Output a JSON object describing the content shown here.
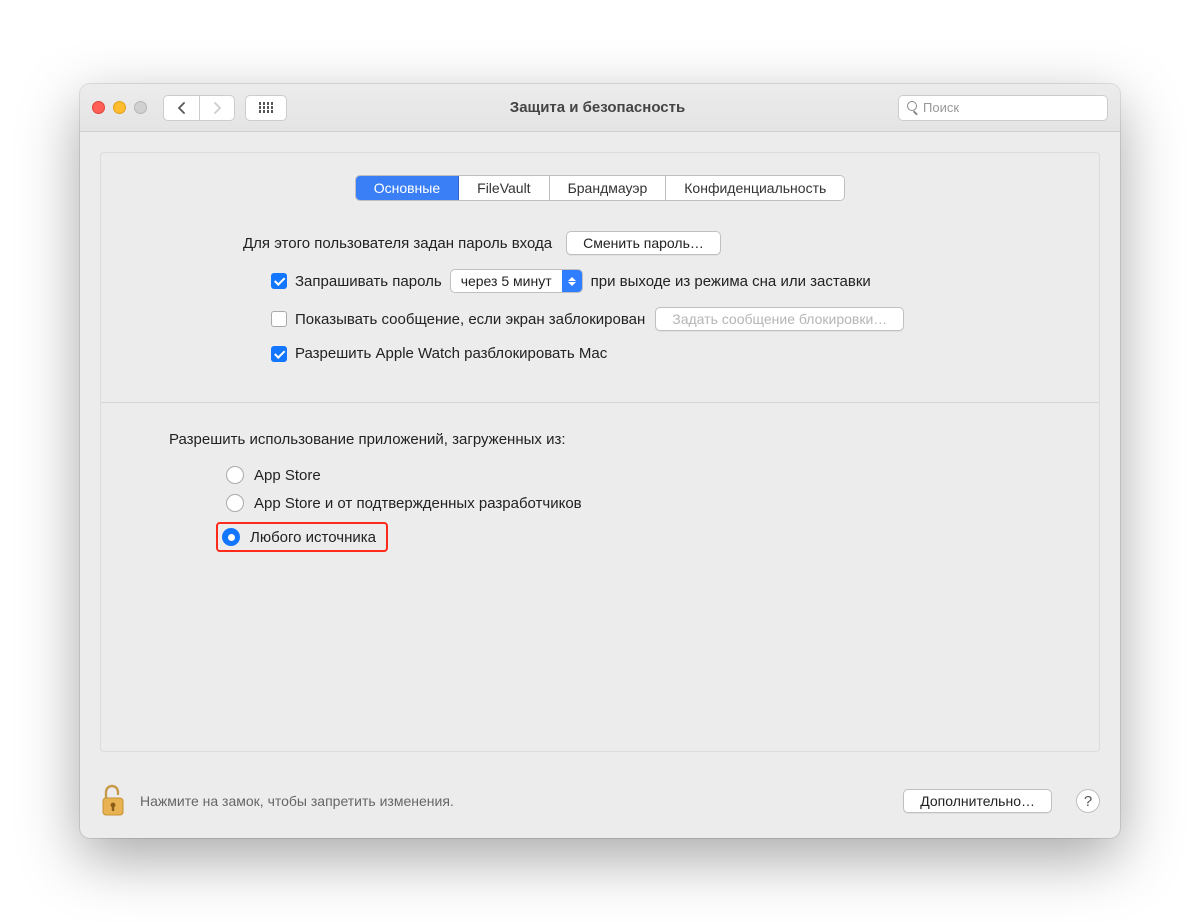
{
  "window": {
    "title": "Защита и безопасность",
    "search_placeholder": "Поиск"
  },
  "tabs": [
    {
      "id": "general",
      "label": "Основные",
      "active": true
    },
    {
      "id": "filevault",
      "label": "FileVault",
      "active": false
    },
    {
      "id": "firewall",
      "label": "Брандмауэр",
      "active": false
    },
    {
      "id": "privacy",
      "label": "Конфиденциальность",
      "active": false
    }
  ],
  "login": {
    "password_set_label": "Для этого пользователя задан пароль входа",
    "change_password_btn": "Сменить пароль…",
    "require_password_label": "Запрашивать пароль",
    "delay_value": "через 5 минут",
    "after_sleep_label": "при выходе из режима сна или заставки",
    "show_message_label": "Показывать сообщение, если экран заблокирован",
    "set_lock_message_btn": "Задать сообщение блокировки…",
    "allow_apple_watch_label": "Разрешить Apple Watch разблокировать Mac"
  },
  "gatekeeper": {
    "section_title": "Разрешить использование приложений, загруженных из:",
    "options": [
      {
        "id": "appstore",
        "label": "App Store",
        "selected": false
      },
      {
        "id": "identified",
        "label": "App Store и от подтвержденных разработчиков",
        "selected": false
      },
      {
        "id": "anywhere",
        "label": "Любого источника",
        "selected": true
      }
    ]
  },
  "footer": {
    "lock_text": "Нажмите на замок, чтобы запретить изменения.",
    "advanced_btn": "Дополнительно…",
    "help": "?"
  }
}
